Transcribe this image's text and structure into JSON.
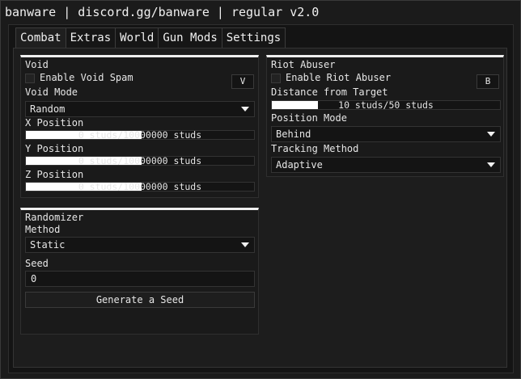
{
  "window": {
    "title": "banware | discord.gg/banware | regular v2.0"
  },
  "tabs": [
    {
      "label": "Combat",
      "active": true
    },
    {
      "label": "Extras"
    },
    {
      "label": "World"
    },
    {
      "label": "Gun Mods"
    },
    {
      "label": "Settings"
    }
  ],
  "void": {
    "title": "Void",
    "enable_label": "Enable Void Spam",
    "enable_checked": false,
    "keybind": "V",
    "mode_label": "Void Mode",
    "mode_value": "Random",
    "x_label": "X Position",
    "x_text": "0 studs/10000000 studs",
    "x_value": 0,
    "y_label": "Y Position",
    "y_text": "0 studs/10000000 studs",
    "y_value": 0,
    "z_label": "Z Position",
    "z_text": "0 studs/10000000 studs",
    "z_value": 0
  },
  "randomizer": {
    "title": "Randomizer",
    "method_label": "Method",
    "method_value": "Static",
    "seed_label": "Seed",
    "seed_value": "0",
    "generate_label": "Generate a Seed"
  },
  "riot": {
    "title": "Riot Abuser",
    "enable_label": "Enable Riot Abuser",
    "enable_checked": false,
    "keybind": "B",
    "distance_label": "Distance from Target",
    "distance_text": "10 studs/50 studs",
    "distance_value": 10,
    "distance_max": 50,
    "position_label": "Position Mode",
    "position_value": "Behind",
    "tracking_label": "Tracking Method",
    "tracking_value": "Adaptive"
  }
}
